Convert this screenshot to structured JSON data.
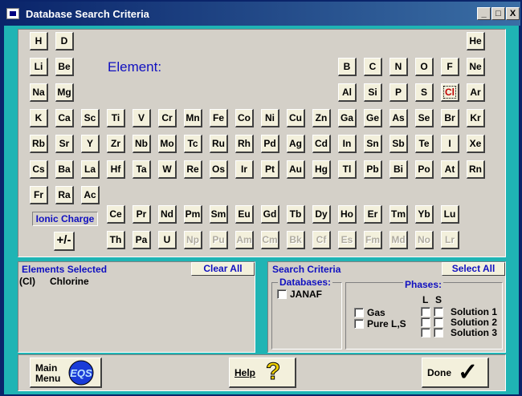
{
  "window": {
    "title": "Database Search Criteria",
    "min_label": "_",
    "max_label": "□",
    "close_label": "X"
  },
  "elements": [
    {
      "symbol": "H"
    },
    {
      "symbol": "D"
    },
    {
      "symbol": "He"
    },
    {
      "symbol": "Li"
    },
    {
      "symbol": "Be"
    },
    {
      "symbol": "B"
    },
    {
      "symbol": "C"
    },
    {
      "symbol": "N"
    },
    {
      "symbol": "O"
    },
    {
      "symbol": "F"
    },
    {
      "symbol": "Ne"
    },
    {
      "symbol": "Na"
    },
    {
      "symbol": "Mg"
    },
    {
      "symbol": "Al"
    },
    {
      "symbol": "Si"
    },
    {
      "symbol": "P"
    },
    {
      "symbol": "S"
    },
    {
      "symbol": "Cl",
      "selected": true
    },
    {
      "symbol": "Ar"
    },
    {
      "symbol": "K"
    },
    {
      "symbol": "Ca"
    },
    {
      "symbol": "Sc"
    },
    {
      "symbol": "Ti"
    },
    {
      "symbol": "V"
    },
    {
      "symbol": "Cr"
    },
    {
      "symbol": "Mn"
    },
    {
      "symbol": "Fe"
    },
    {
      "symbol": "Co"
    },
    {
      "symbol": "Ni"
    },
    {
      "symbol": "Cu"
    },
    {
      "symbol": "Zn"
    },
    {
      "symbol": "Ga"
    },
    {
      "symbol": "Ge"
    },
    {
      "symbol": "As"
    },
    {
      "symbol": "Se"
    },
    {
      "symbol": "Br"
    },
    {
      "symbol": "Kr"
    },
    {
      "symbol": "Rb"
    },
    {
      "symbol": "Sr"
    },
    {
      "symbol": "Y"
    },
    {
      "symbol": "Zr"
    },
    {
      "symbol": "Nb"
    },
    {
      "symbol": "Mo"
    },
    {
      "symbol": "Tc"
    },
    {
      "symbol": "Ru"
    },
    {
      "symbol": "Rh"
    },
    {
      "symbol": "Pd"
    },
    {
      "symbol": "Ag"
    },
    {
      "symbol": "Cd"
    },
    {
      "symbol": "In"
    },
    {
      "symbol": "Sn"
    },
    {
      "symbol": "Sb"
    },
    {
      "symbol": "Te"
    },
    {
      "symbol": "I"
    },
    {
      "symbol": "Xe"
    },
    {
      "symbol": "Cs"
    },
    {
      "symbol": "Ba"
    },
    {
      "symbol": "La"
    },
    {
      "symbol": "Hf"
    },
    {
      "symbol": "Ta"
    },
    {
      "symbol": "W"
    },
    {
      "symbol": "Re"
    },
    {
      "symbol": "Os"
    },
    {
      "symbol": "Ir"
    },
    {
      "symbol": "Pt"
    },
    {
      "symbol": "Au"
    },
    {
      "symbol": "Hg"
    },
    {
      "symbol": "Tl"
    },
    {
      "symbol": "Pb"
    },
    {
      "symbol": "Bi"
    },
    {
      "symbol": "Po"
    },
    {
      "symbol": "At"
    },
    {
      "symbol": "Rn"
    },
    {
      "symbol": "Fr"
    },
    {
      "symbol": "Ra"
    },
    {
      "symbol": "Ac"
    },
    {
      "symbol": "Ce"
    },
    {
      "symbol": "Pr"
    },
    {
      "symbol": "Nd"
    },
    {
      "symbol": "Pm"
    },
    {
      "symbol": "Sm"
    },
    {
      "symbol": "Eu"
    },
    {
      "symbol": "Gd"
    },
    {
      "symbol": "Tb"
    },
    {
      "symbol": "Dy"
    },
    {
      "symbol": "Ho"
    },
    {
      "symbol": "Er"
    },
    {
      "symbol": "Tm"
    },
    {
      "symbol": "Yb"
    },
    {
      "symbol": "Lu"
    },
    {
      "symbol": "Th"
    },
    {
      "symbol": "Pa"
    },
    {
      "symbol": "U"
    },
    {
      "symbol": "Np",
      "disabled": true
    },
    {
      "symbol": "Pu",
      "disabled": true
    },
    {
      "symbol": "Am",
      "disabled": true
    },
    {
      "symbol": "Cm",
      "disabled": true
    },
    {
      "symbol": "Bk",
      "disabled": true
    },
    {
      "symbol": "Cf",
      "disabled": true
    },
    {
      "symbol": "Es",
      "disabled": true
    },
    {
      "symbol": "Fm",
      "disabled": true
    },
    {
      "symbol": "Md",
      "disabled": true
    },
    {
      "symbol": "No",
      "disabled": true
    },
    {
      "symbol": "Lr",
      "disabled": true
    }
  ],
  "element_label": "Element:",
  "ionic_charge_label": "Ionic Charge",
  "plus_minus_label": "+/-",
  "elements_selected": {
    "header": "Elements Selected",
    "clear_all": "Clear All",
    "rows": [
      {
        "symbol": "(Cl)",
        "name": "Chlorine"
      }
    ]
  },
  "search_criteria": {
    "header": "Search Criteria",
    "select_all": "Select All",
    "databases_title": "Databases:",
    "databases": [
      {
        "label": "JANAF",
        "checked": false
      }
    ],
    "phases_title": "Phases:",
    "col_l": "L",
    "col_s": "S",
    "gas_label": "Gas",
    "pure_label": "Pure L,S",
    "solutions": [
      "Solution 1",
      "Solution 2",
      "Solution 3"
    ]
  },
  "bottom": {
    "main_menu_line1": "Main",
    "main_menu_line2": "Menu",
    "eqs_logo": "EQS",
    "help_label": "Help",
    "help_icon": "?",
    "done_label": "Done",
    "done_icon": "✓"
  },
  "colors": {
    "client_teal": "#1fb4b4",
    "panel_gray": "#d4d0c8",
    "button_face": "#f3f0dc",
    "header_blue": "#1010c0",
    "eqs_blue": "#1a3cd8",
    "help_yellow": "#f0d000"
  }
}
